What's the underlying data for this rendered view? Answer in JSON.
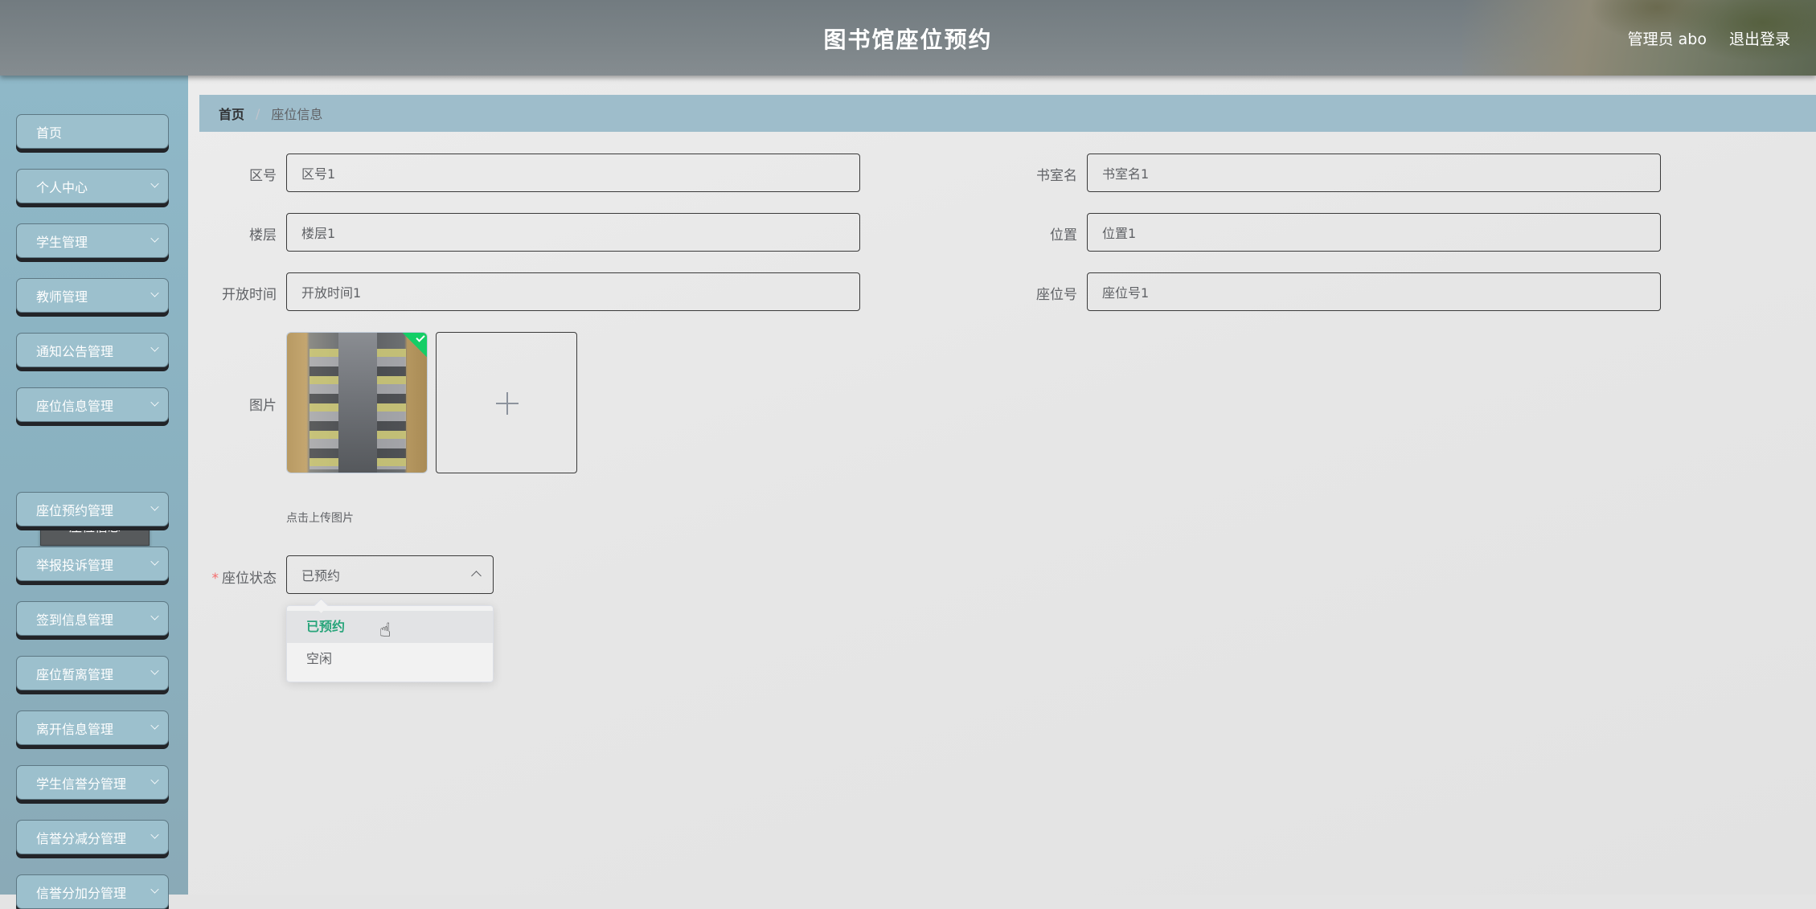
{
  "header": {
    "title": "图书馆座位预约",
    "user_label": "管理员 abo",
    "logout_label": "退出登录"
  },
  "sidebar": {
    "items": [
      {
        "label": "首页",
        "has_submenu": false
      },
      {
        "label": "个人中心",
        "has_submenu": true
      },
      {
        "label": "学生管理",
        "has_submenu": true
      },
      {
        "label": "教师管理",
        "has_submenu": true
      },
      {
        "label": "通知公告管理",
        "has_submenu": true
      },
      {
        "label": "座位信息管理",
        "has_submenu": true,
        "expanded": true
      },
      {
        "label": "座位预约管理",
        "has_submenu": true
      },
      {
        "label": "举报投诉管理",
        "has_submenu": true
      },
      {
        "label": "签到信息管理",
        "has_submenu": true
      },
      {
        "label": "座位暂离管理",
        "has_submenu": true
      },
      {
        "label": "离开信息管理",
        "has_submenu": true
      },
      {
        "label": "学生信誉分管理",
        "has_submenu": true
      },
      {
        "label": "信誉分减分管理",
        "has_submenu": true
      },
      {
        "label": "信誉分加分管理",
        "has_submenu": true
      }
    ],
    "active_submenu": "座位信息"
  },
  "breadcrumb": {
    "home": "首页",
    "separator": "/",
    "current": "座位信息"
  },
  "form": {
    "zone": {
      "label": "区号",
      "value": "区号1"
    },
    "room_name": {
      "label": "书室名",
      "value": "书室名1"
    },
    "floor": {
      "label": "楼层",
      "value": "楼层1"
    },
    "position": {
      "label": "位置",
      "value": "位置1"
    },
    "open_time": {
      "label": "开放时间",
      "value": "开放时间1"
    },
    "seat_no": {
      "label": "座位号",
      "value": "座位号1"
    },
    "picture": {
      "label": "图片",
      "hint": "点击上传图片",
      "uploaded": true
    },
    "seat_status": {
      "required_mark": "*",
      "label": "座位状态",
      "value": "已预约",
      "options": [
        "已预约",
        "空闲"
      ],
      "selected_index": 0
    }
  },
  "colors": {
    "sidebar_bg": "#8fb8c8",
    "breadcrumb_bg": "#9ebdcb",
    "selected_option": "#29a57b",
    "required": "#f56c6c",
    "upload_success": "#13ce66"
  }
}
